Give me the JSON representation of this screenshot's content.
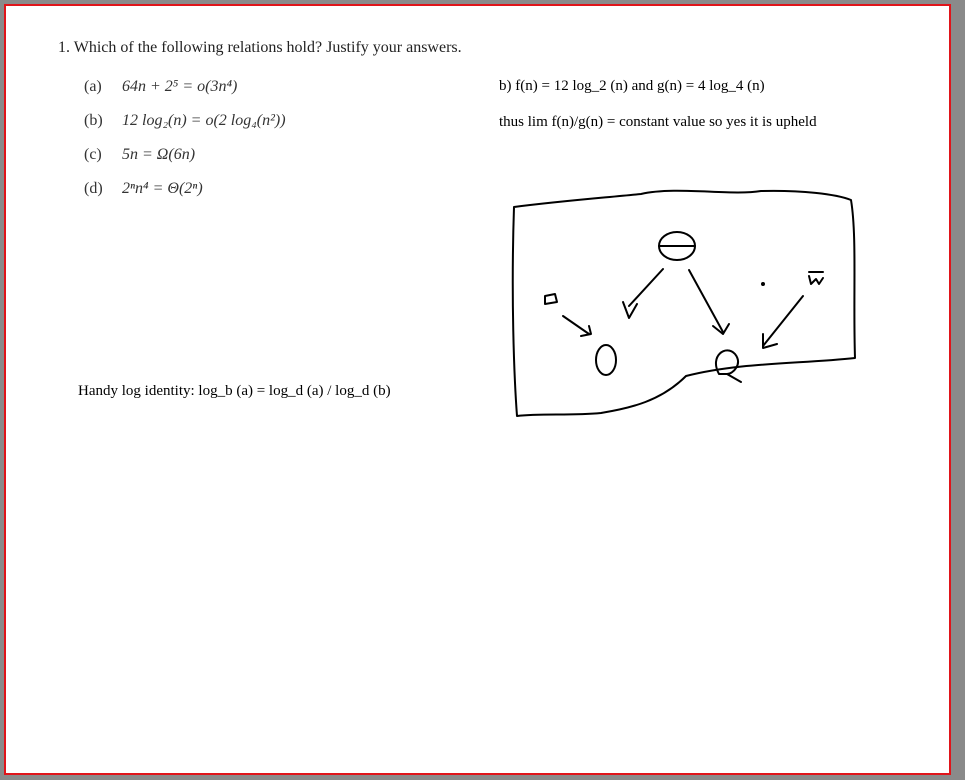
{
  "question": "1. Which of the following relations hold? Justify your answers.",
  "parts": [
    {
      "label": "(a)",
      "expr": "64n + 2⁵ = o(3n⁴)"
    },
    {
      "label": "(b)",
      "expr": "12 log₂(n) = o(2 log₄(n²))"
    },
    {
      "label": "(c)",
      "expr": "5n = Ω(6n)"
    },
    {
      "label": "(d)",
      "expr": "2ⁿn⁴ = Θ(2ⁿ)"
    }
  ],
  "notes": {
    "answer_b": "b) f(n) = 12 log_2 (n) and g(n) = 4 log_4 (n)",
    "conclusion": "thus lim f(n)/g(n) = constant value so yes it is upheld",
    "identity": "Handy log identity:  log_b (a) = log_d (a) / log_d (b)"
  },
  "colors": {
    "border": "#e0141a",
    "background": "#8a8a8a",
    "ink": "#000000"
  }
}
